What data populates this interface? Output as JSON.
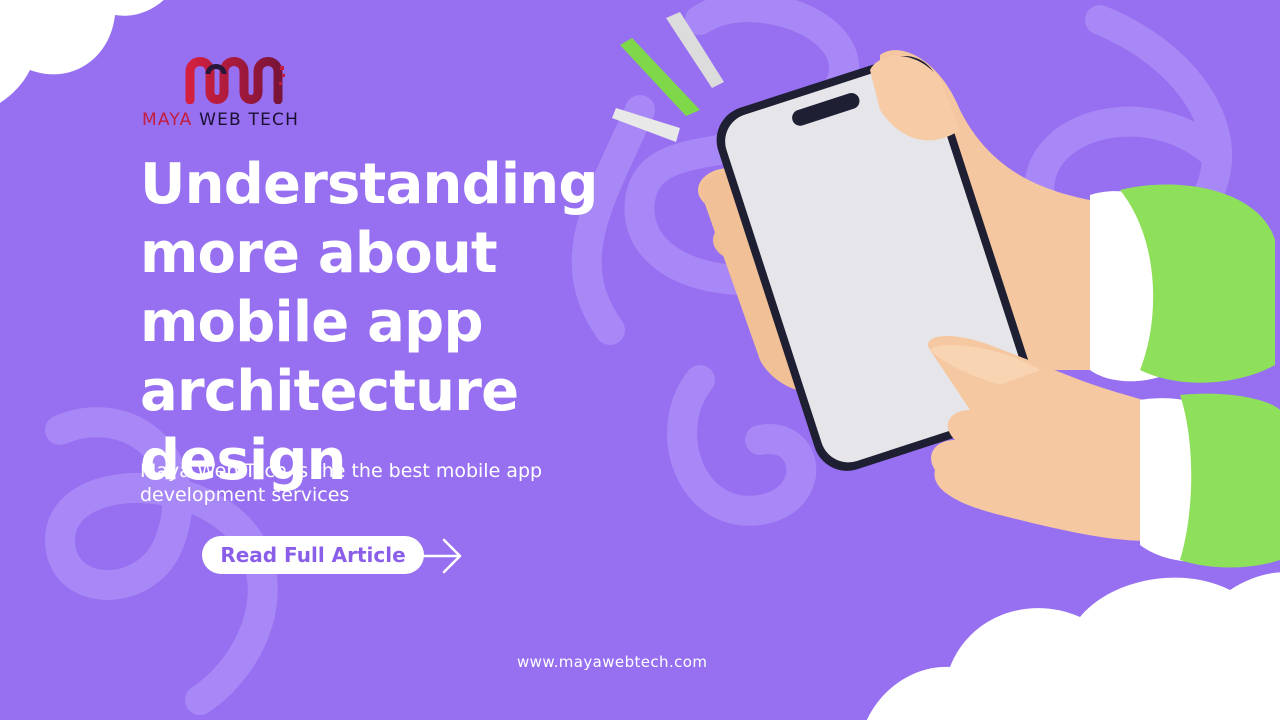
{
  "brand": {
    "name_part1": "MAYA",
    "name_part2": " WEB TECH",
    "logo_icon": "mw-monogram-logo"
  },
  "headline": {
    "lines": [
      "Understanding",
      "more about",
      "mobile app",
      "architecture",
      "design"
    ]
  },
  "subtitle": "Maya Web Tech is the the best mobile app development services",
  "cta": {
    "label": "Read Full Article",
    "icon": "arrow-right-icon"
  },
  "footer": {
    "url": "www.mayawebtech.com"
  },
  "illustration": {
    "subject": "hands-holding-smartphone-illustration",
    "decorative_icons": [
      "spark-lines-icon",
      "cloud-shape"
    ]
  },
  "colors": {
    "background": "#9670f0",
    "swirl": "#a98af5",
    "headline_text": "#ffffff",
    "cta_background": "#ffffff",
    "cta_text": "#8a5ee8",
    "logo_red": "#c41c3c",
    "logo_dark": "#1b1030",
    "sleeve_green": "#8ee05a",
    "spark_green": "#7ed84a"
  }
}
